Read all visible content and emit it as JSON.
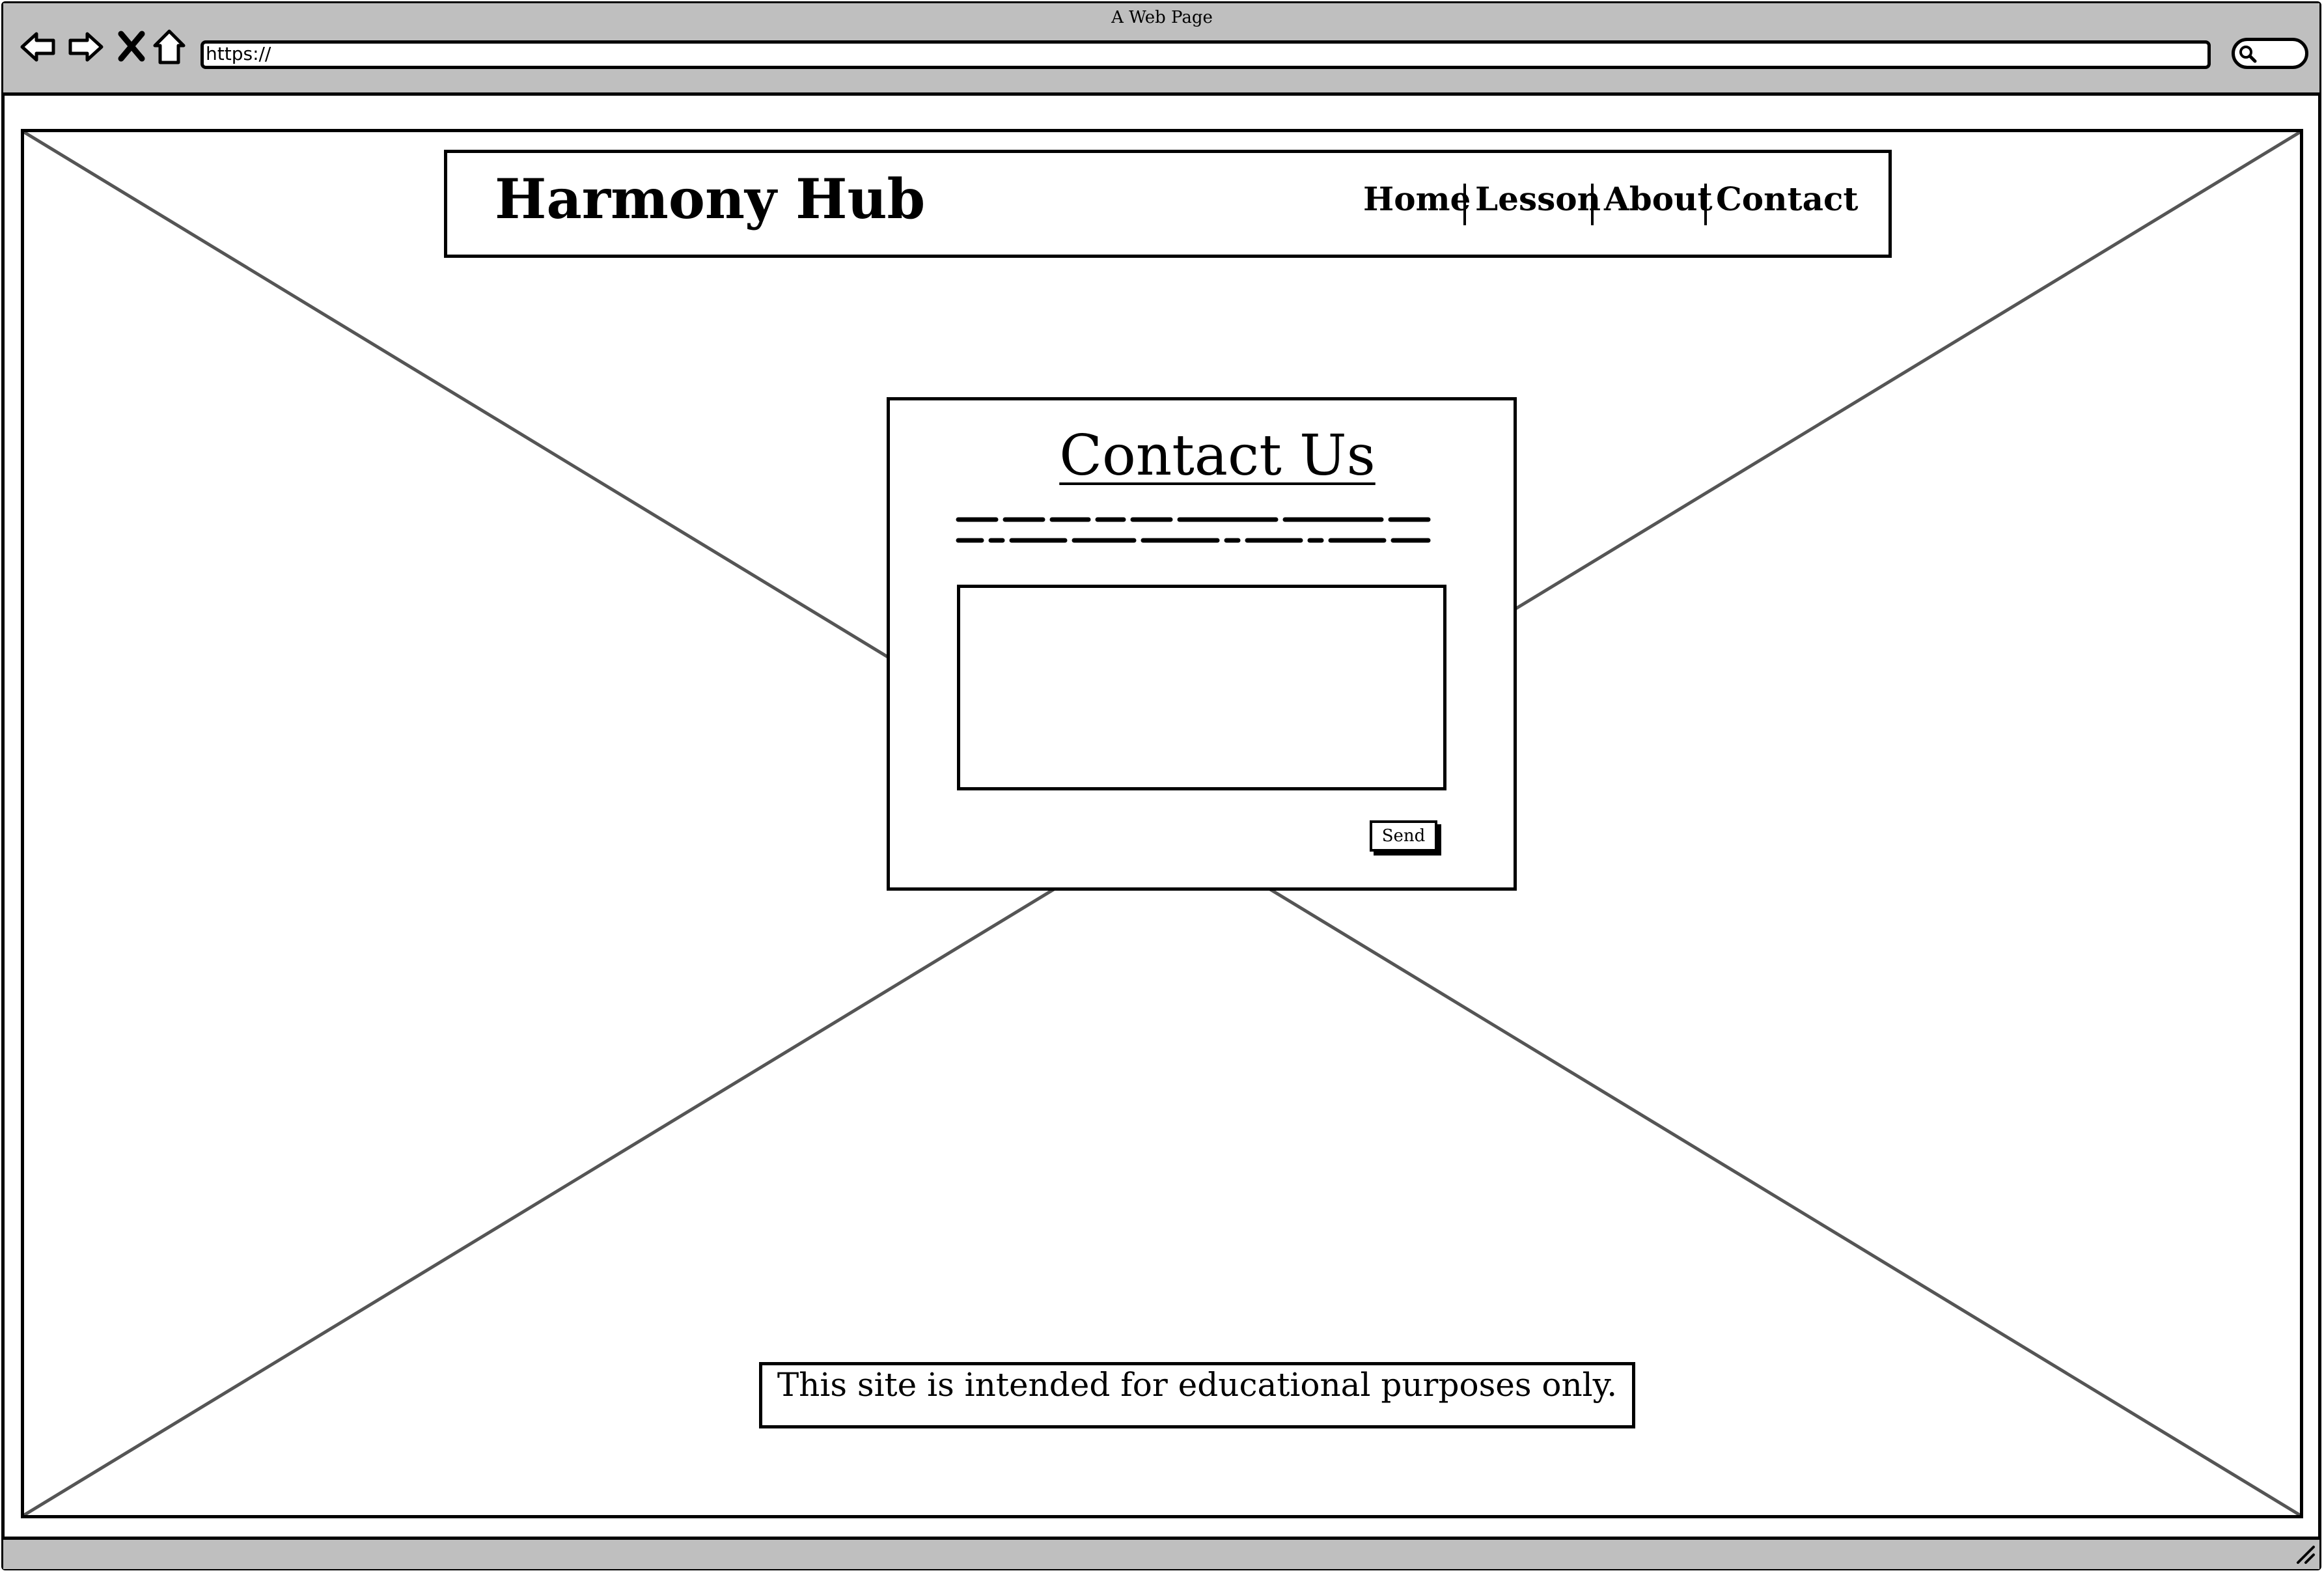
{
  "browser": {
    "title": "A Web Page",
    "address": "https://",
    "icons": [
      "back-arrow-icon",
      "forward-arrow-icon",
      "close-x-icon",
      "home-icon",
      "search-icon",
      "resize-grip-icon"
    ]
  },
  "site": {
    "brand": "Harmony Hub",
    "nav": [
      {
        "label": "Home"
      },
      {
        "label": "Lesson"
      },
      {
        "label": "About"
      },
      {
        "label": "Contact"
      }
    ]
  },
  "contact": {
    "title": "Contact Us",
    "message_value": "",
    "send_label": "Send"
  },
  "footer": {
    "text": "This site is intended for educational purposes only."
  },
  "colors": {
    "chrome_gray": "#bfbfbf",
    "outline": "#000000",
    "placeholder_line": "#555555",
    "background": "#ffffff"
  }
}
